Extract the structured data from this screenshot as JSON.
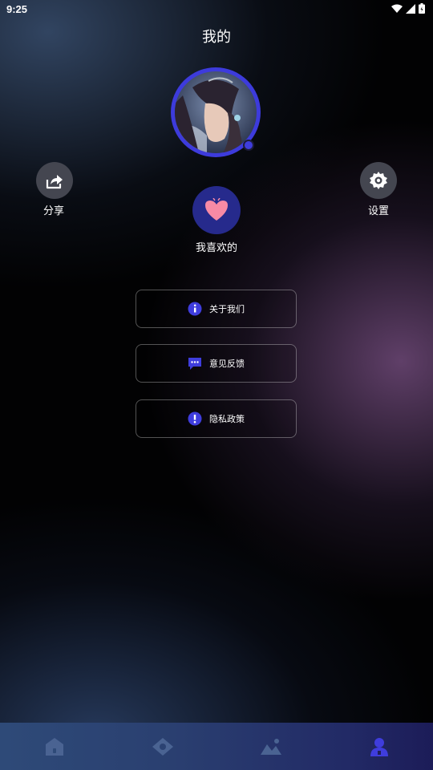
{
  "status_bar": {
    "time": "9:25"
  },
  "header": {
    "title": "我的"
  },
  "actions": {
    "share_label": "分享",
    "settings_label": "设置",
    "favorites_label": "我喜欢的"
  },
  "menu": [
    {
      "label": "关于我们",
      "icon": "info-icon"
    },
    {
      "label": "意见反馈",
      "icon": "chat-icon"
    },
    {
      "label": "隐私政策",
      "icon": "alert-icon"
    }
  ],
  "tabs": [
    {
      "icon": "home-icon",
      "active": false
    },
    {
      "icon": "eye-icon",
      "active": false
    },
    {
      "icon": "gallery-icon",
      "active": false
    },
    {
      "icon": "profile-icon",
      "active": true
    }
  ],
  "colors": {
    "accent": "#3f3ddd",
    "heart": "#f78aa5",
    "tab_inactive": "#4a6392",
    "tab_active": "#3f3ddd"
  }
}
